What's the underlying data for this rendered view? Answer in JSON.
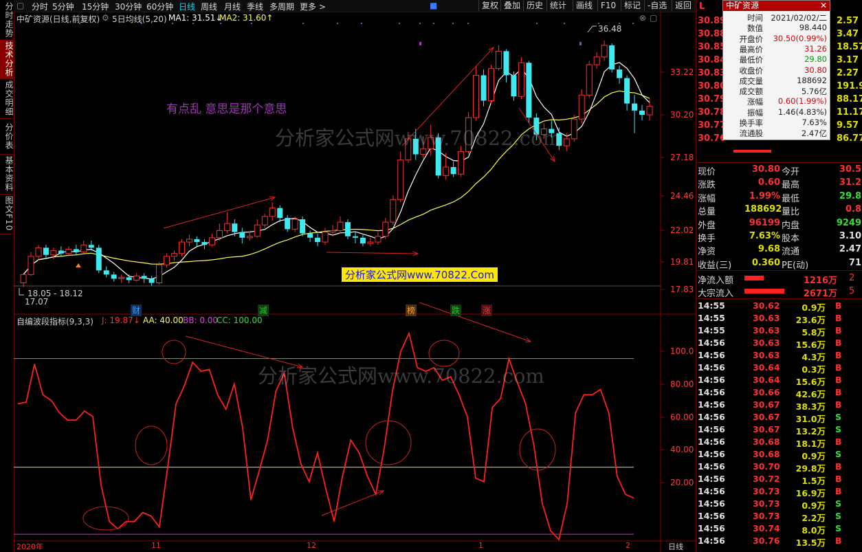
{
  "sidebar": {
    "tabs": [
      {
        "label": "分时走势",
        "active": false
      },
      {
        "label": "技术分析",
        "active": true
      },
      {
        "label": "成交明细",
        "active": false
      },
      {
        "label": "分价表",
        "active": false
      },
      {
        "label": "基本资料",
        "active": false
      },
      {
        "label": "图文F10",
        "active": false
      }
    ]
  },
  "toolbar": {
    "periods": [
      "分时",
      "5分钟",
      "15分钟",
      "30分钟",
      "60分钟",
      "日线",
      "周线",
      "月线",
      "季线",
      "多周期",
      "更多 >"
    ],
    "active_period": "日线",
    "right_buttons": [
      "复权",
      "叠加",
      "历史",
      "统计",
      "画线",
      "F10",
      "标记",
      "-自选",
      "返回"
    ]
  },
  "main_chart": {
    "title": "中矿资源(日线,前复权)",
    "indicator_name": "5日均线(5,20)",
    "ma1": "MA1: 31.51↓",
    "ma2": "MA2: 31.60↑",
    "price_axis": [
      "33.22",
      "30.20",
      "27.18",
      "24.46",
      "22.02",
      "19.81",
      "17.83"
    ],
    "high_marker": "36.48",
    "low_marker_1": "18.05 - 18.12",
    "low_marker_2": "17.07",
    "annotation": "有点乱 意思是那个意思",
    "watermark": "分析家公式网www.70822.com",
    "banner": "分析家公式网www.70822.Com",
    "event_tags": [
      {
        "label": "财",
        "color": "#3aa0ff"
      },
      {
        "label": "减",
        "color": "#30c030"
      },
      {
        "label": "榜",
        "color": "#ffa020"
      },
      {
        "label": "跌",
        "color": "#30c030"
      },
      {
        "label": "涨",
        "color": "#ff3030"
      }
    ]
  },
  "sub_chart": {
    "title": "自编波段指标(9,3,3)",
    "j": "J: 19.87↓",
    "aa": "AA: 40.00",
    "bb": "BB: 0.00",
    "cc": "CC: 100.00",
    "axis": [
      "100.0",
      "80.00",
      "60.00",
      "40.00",
      "20.00"
    ],
    "watermark": "分析家公式网www.70822.com",
    "j_values": [
      75,
      76,
      97,
      80,
      77,
      70,
      66,
      66,
      71,
      68,
      30,
      10,
      6,
      10,
      10,
      15,
      13,
      7,
      40,
      75,
      85,
      98,
      93,
      94,
      80,
      72,
      86,
      62,
      22,
      38,
      55,
      82,
      92,
      62,
      42,
      32,
      48,
      28,
      10,
      35,
      55,
      48,
      35,
      25,
      50,
      82,
      104,
      114,
      95,
      93,
      95,
      88,
      90,
      80,
      68,
      34,
      32,
      73,
      78,
      100,
      87,
      75,
      52,
      20,
      5,
      0,
      20,
      70,
      80,
      80,
      83,
      70,
      35,
      25,
      23
    ],
    "j_max": 120,
    "j_min": 0
  },
  "bottom_axis": [
    "2020年",
    "11",
    "12",
    "1",
    "2"
  ],
  "bottom_right_label": "日线",
  "quote_popup": {
    "title": "中矿资源",
    "rows": [
      {
        "k": "时间",
        "v": "2021/02/02/二"
      },
      {
        "k": "数值",
        "v": "98.440"
      },
      {
        "k": "开盘价",
        "v": "30.50(0.99%)"
      },
      {
        "k": "最高价",
        "v": "31.26"
      },
      {
        "k": "最低价",
        "v": "29.80"
      },
      {
        "k": "收盘价",
        "v": "30.80"
      },
      {
        "k": "成交量",
        "v": "188692"
      },
      {
        "k": "成交额",
        "v": "5.76亿"
      },
      {
        "k": "涨幅",
        "v": "0.60(1.99%)"
      },
      {
        "k": "振幅",
        "v": "1.46(4.83%)"
      },
      {
        "k": "换手率",
        "v": "7.63%"
      },
      {
        "k": "流通股",
        "v": "2.47亿"
      }
    ]
  },
  "order_book": {
    "header_left": "L",
    "rows": [
      {
        "price": "30.89",
        "right": "2.57"
      },
      {
        "price": "30.88",
        "right": "3.47"
      },
      {
        "price": "30.85",
        "right": "18.57"
      },
      {
        "price": "30.84",
        "right": "3.17"
      },
      {
        "price": "30.83",
        "right": "2.27"
      },
      {
        "price": "30.80",
        "right": "191.97"
      },
      {
        "price": "30.79",
        "right": "88.17"
      },
      {
        "price": "30.78",
        "right": "11.17"
      },
      {
        "price": "30.77",
        "right": "9.57"
      },
      {
        "price": "30.76",
        "right": "86.77"
      }
    ]
  },
  "stats": [
    {
      "k1": "现价",
      "v1": "30.80",
      "k2": "今开",
      "v2": "30.5"
    },
    {
      "k1": "涨跌",
      "v1": "0.60",
      "k2": "最高",
      "v2": "31.2"
    },
    {
      "k1": "涨幅",
      "v1": "1.99%",
      "k2": "最低",
      "v2": "29.8"
    },
    {
      "k1": "总量",
      "v1": "188692",
      "k2": "量比",
      "v2": "0.8"
    },
    {
      "k1": "外盘",
      "v1": "96199",
      "k2": "内盘",
      "v2": "9249"
    },
    {
      "k1": "换手",
      "v1": "7.63%",
      "k2": "股本",
      "v2": "3.10"
    },
    {
      "k1": "净资",
      "v1": "9.68",
      "k2": "流通",
      "v2": "2.47"
    },
    {
      "k1": "收益(三)",
      "v1": "0.360",
      "k2": "PE(动)",
      "v2": "71"
    }
  ],
  "flows": [
    {
      "k": "净流入额",
      "v": "1216万",
      "r": "2"
    },
    {
      "k": "大宗流入",
      "v": "2671万",
      "r": "5"
    }
  ],
  "ticks": [
    {
      "t": "14:55",
      "p": "30.62",
      "v": "0.9万",
      "s": "B"
    },
    {
      "t": "14:55",
      "p": "30.63",
      "v": "23.6万",
      "s": "B"
    },
    {
      "t": "14:55",
      "p": "30.63",
      "v": "5.8万",
      "s": "B"
    },
    {
      "t": "14:56",
      "p": "30.63",
      "v": "15.6万",
      "s": "B"
    },
    {
      "t": "14:56",
      "p": "30.63",
      "v": "4.3万",
      "s": "B"
    },
    {
      "t": "14:56",
      "p": "30.64",
      "v": "0.3万",
      "s": "B"
    },
    {
      "t": "14:56",
      "p": "30.64",
      "v": "15.6万",
      "s": "B"
    },
    {
      "t": "14:56",
      "p": "30.66",
      "v": "42.6万",
      "s": "B"
    },
    {
      "t": "14:56",
      "p": "30.67",
      "v": "38.3万",
      "s": "B"
    },
    {
      "t": "14:56",
      "p": "30.67",
      "v": "31.0万",
      "s": "S"
    },
    {
      "t": "14:56",
      "p": "30.67",
      "v": "13.2万",
      "s": "S"
    },
    {
      "t": "14:56",
      "p": "30.68",
      "v": "18.1万",
      "s": "B"
    },
    {
      "t": "14:56",
      "p": "30.68",
      "v": "0.9万",
      "s": "S"
    },
    {
      "t": "14:56",
      "p": "30.70",
      "v": "29.8万",
      "s": "B"
    },
    {
      "t": "14:56",
      "p": "30.72",
      "v": "1.5万",
      "s": "B"
    },
    {
      "t": "14:56",
      "p": "30.73",
      "v": "16.9万",
      "s": "B"
    },
    {
      "t": "14:56",
      "p": "30.73",
      "v": "0.9万",
      "s": "S"
    },
    {
      "t": "14:56",
      "p": "30.73",
      "v": "2.2万",
      "s": "S"
    },
    {
      "t": "14:56",
      "p": "30.74",
      "v": "8.0万",
      "s": "S"
    },
    {
      "t": "14:56",
      "p": "30.76",
      "v": "13.5万",
      "s": "B"
    }
  ],
  "candles": [
    [
      18.3,
      18.9,
      18.0,
      19.0
    ],
    [
      18.9,
      20.2,
      18.8,
      20.5
    ],
    [
      20.2,
      20.8,
      19.9,
      21.0
    ],
    [
      20.8,
      20.3,
      20.1,
      21.0
    ],
    [
      20.3,
      20.6,
      20.0,
      20.8
    ],
    [
      20.6,
      20.4,
      20.2,
      20.9
    ],
    [
      20.4,
      20.7,
      20.2,
      20.9
    ],
    [
      20.7,
      20.5,
      20.3,
      21.0
    ],
    [
      20.5,
      21.0,
      20.4,
      21.3
    ],
    [
      21.0,
      20.8,
      20.6,
      21.3
    ],
    [
      20.8,
      19.2,
      19.0,
      21.0
    ],
    [
      19.2,
      18.9,
      18.7,
      19.5
    ],
    [
      18.9,
      18.6,
      18.4,
      19.1
    ],
    [
      18.6,
      18.7,
      18.3,
      18.9
    ],
    [
      18.7,
      18.5,
      18.3,
      18.9
    ],
    [
      18.5,
      18.8,
      18.4,
      19.0
    ],
    [
      18.8,
      18.6,
      18.3,
      19.0
    ],
    [
      18.6,
      18.3,
      18.1,
      18.8
    ],
    [
      18.3,
      19.6,
      18.2,
      19.8
    ],
    [
      19.6,
      20.2,
      19.4,
      20.4
    ],
    [
      20.2,
      20.4,
      19.9,
      20.6
    ],
    [
      20.4,
      21.2,
      20.2,
      21.4
    ],
    [
      21.2,
      21.4,
      20.9,
      21.7
    ],
    [
      21.4,
      21.2,
      20.9,
      21.6
    ],
    [
      21.2,
      21.0,
      20.7,
      21.4
    ],
    [
      21.0,
      21.5,
      20.9,
      21.8
    ],
    [
      21.5,
      22.0,
      21.3,
      22.5
    ],
    [
      22.0,
      22.5,
      21.8,
      23.3
    ],
    [
      22.5,
      21.9,
      21.6,
      22.8
    ],
    [
      21.9,
      21.5,
      21.1,
      22.2
    ],
    [
      21.5,
      21.6,
      21.3,
      22.0
    ],
    [
      21.6,
      22.4,
      21.5,
      22.8
    ],
    [
      22.4,
      23.0,
      22.2,
      23.2
    ],
    [
      23.0,
      23.6,
      22.7,
      24.0
    ],
    [
      23.6,
      22.9,
      22.6,
      23.8
    ],
    [
      22.9,
      22.1,
      21.9,
      23.1
    ],
    [
      22.1,
      22.8,
      21.9,
      23.0
    ],
    [
      22.8,
      21.8,
      21.6,
      23.0
    ],
    [
      21.8,
      21.5,
      21.2,
      22.0
    ],
    [
      21.5,
      21.2,
      20.9,
      21.8
    ],
    [
      21.2,
      21.9,
      21.0,
      22.2
    ],
    [
      21.9,
      22.0,
      21.6,
      22.4
    ],
    [
      22.0,
      22.6,
      21.8,
      23.0
    ],
    [
      22.6,
      21.6,
      21.4,
      22.8
    ],
    [
      21.6,
      21.5,
      21.1,
      21.9
    ],
    [
      21.5,
      21.1,
      20.9,
      21.7
    ],
    [
      21.1,
      21.2,
      20.9,
      21.5
    ],
    [
      21.2,
      21.6,
      21.0,
      21.9
    ],
    [
      21.6,
      22.6,
      21.4,
      22.9
    ],
    [
      22.6,
      24.2,
      22.4,
      24.5
    ],
    [
      24.2,
      27.0,
      24.0,
      27.6
    ],
    [
      27.0,
      28.5,
      26.8,
      29.0
    ],
    [
      28.5,
      27.4,
      27.0,
      29.2
    ],
    [
      27.4,
      27.8,
      27.1,
      28.7
    ],
    [
      27.8,
      28.6,
      27.3,
      29.5
    ],
    [
      28.6,
      25.9,
      25.7,
      28.9
    ],
    [
      25.9,
      26.5,
      25.6,
      27.5
    ],
    [
      26.5,
      26.0,
      25.8,
      26.9
    ],
    [
      26.0,
      27.6,
      25.8,
      28.0
    ],
    [
      27.6,
      30.0,
      27.4,
      30.4
    ],
    [
      30.0,
      33.0,
      29.8,
      33.8
    ],
    [
      33.0,
      31.2,
      30.8,
      33.5
    ],
    [
      31.2,
      33.6,
      31.0,
      34.0
    ],
    [
      33.6,
      35.4,
      33.4,
      36.0
    ],
    [
      35.4,
      33.0,
      32.5,
      35.6
    ],
    [
      33.0,
      31.5,
      31.2,
      33.3
    ],
    [
      31.5,
      34.2,
      31.3,
      34.8
    ],
    [
      34.2,
      30.0,
      29.6,
      34.4
    ],
    [
      30.0,
      28.8,
      28.4,
      30.3
    ],
    [
      28.8,
      29.2,
      28.5,
      29.6
    ],
    [
      29.2,
      28.9,
      28.6,
      29.8
    ],
    [
      28.9,
      28.0,
      27.7,
      29.3
    ],
    [
      28.0,
      28.5,
      27.6,
      28.9
    ],
    [
      28.5,
      29.9,
      28.3,
      30.2
    ],
    [
      29.9,
      31.6,
      29.6,
      32.0
    ],
    [
      31.6,
      34.0,
      31.4,
      34.4
    ],
    [
      34.0,
      34.8,
      33.6,
      35.3
    ],
    [
      34.8,
      36.0,
      34.4,
      36.5
    ],
    [
      36.0,
      33.5,
      33.2,
      36.2
    ],
    [
      33.5,
      32.8,
      32.4,
      33.9
    ],
    [
      32.8,
      31.0,
      30.5,
      33.0
    ],
    [
      31.0,
      30.5,
      28.9,
      31.6
    ],
    [
      30.5,
      30.2,
      29.8,
      30.9
    ],
    [
      30.2,
      30.8,
      29.8,
      31.3
    ]
  ]
}
